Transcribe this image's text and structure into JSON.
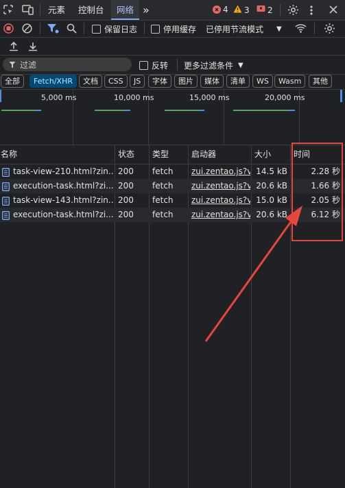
{
  "tabs": {
    "elements": "元素",
    "console": "控制台",
    "network": "网络",
    "more": "»"
  },
  "status": {
    "errors": "4",
    "warnings": "3",
    "issues": "2",
    "error_color": "#e46962",
    "warning_color": "#f9ab00",
    "issue_color": "#e46962"
  },
  "toolbar": {
    "preserve_log": "保留日志",
    "disable_cache": "停用缓存",
    "throttling": "已停用节流模式"
  },
  "filter": {
    "placeholder": "过滤",
    "invert": "反转",
    "more_filters": "更多过滤条件"
  },
  "types": [
    "全部",
    "Fetch/XHR",
    "文档",
    "CSS",
    "JS",
    "字体",
    "图片",
    "媒体",
    "清单",
    "WS",
    "Wasm",
    "其他"
  ],
  "overview": {
    "ticks": [
      "5,000 ms",
      "10,000 ms",
      "15,000 ms",
      "20,000 ms"
    ]
  },
  "table": {
    "columns": [
      "名称",
      "状态",
      "类型",
      "启动器",
      "大小",
      "时间"
    ],
    "rows": [
      {
        "name": "task-view-210.html?zin...",
        "status": "200",
        "type": "fetch",
        "initiator": "zui.zentao.js?v=",
        "size": "14.5 kB",
        "time": "2.28 秒"
      },
      {
        "name": "execution-task.html?zi...",
        "status": "200",
        "type": "fetch",
        "initiator": "zui.zentao.js?v=",
        "size": "20.6 kB",
        "time": "1.66 秒"
      },
      {
        "name": "task-view-143.html?zin...",
        "status": "200",
        "type": "fetch",
        "initiator": "zui.zentao.js?v=",
        "size": "15.0 kB",
        "time": "2.05 秒"
      },
      {
        "name": "execution-task.html?zi...",
        "status": "200",
        "type": "fetch",
        "initiator": "zui.zentao.js?v=",
        "size": "20.6 kB",
        "time": "6.12 秒"
      }
    ]
  },
  "annotation_color": "#e8453c"
}
